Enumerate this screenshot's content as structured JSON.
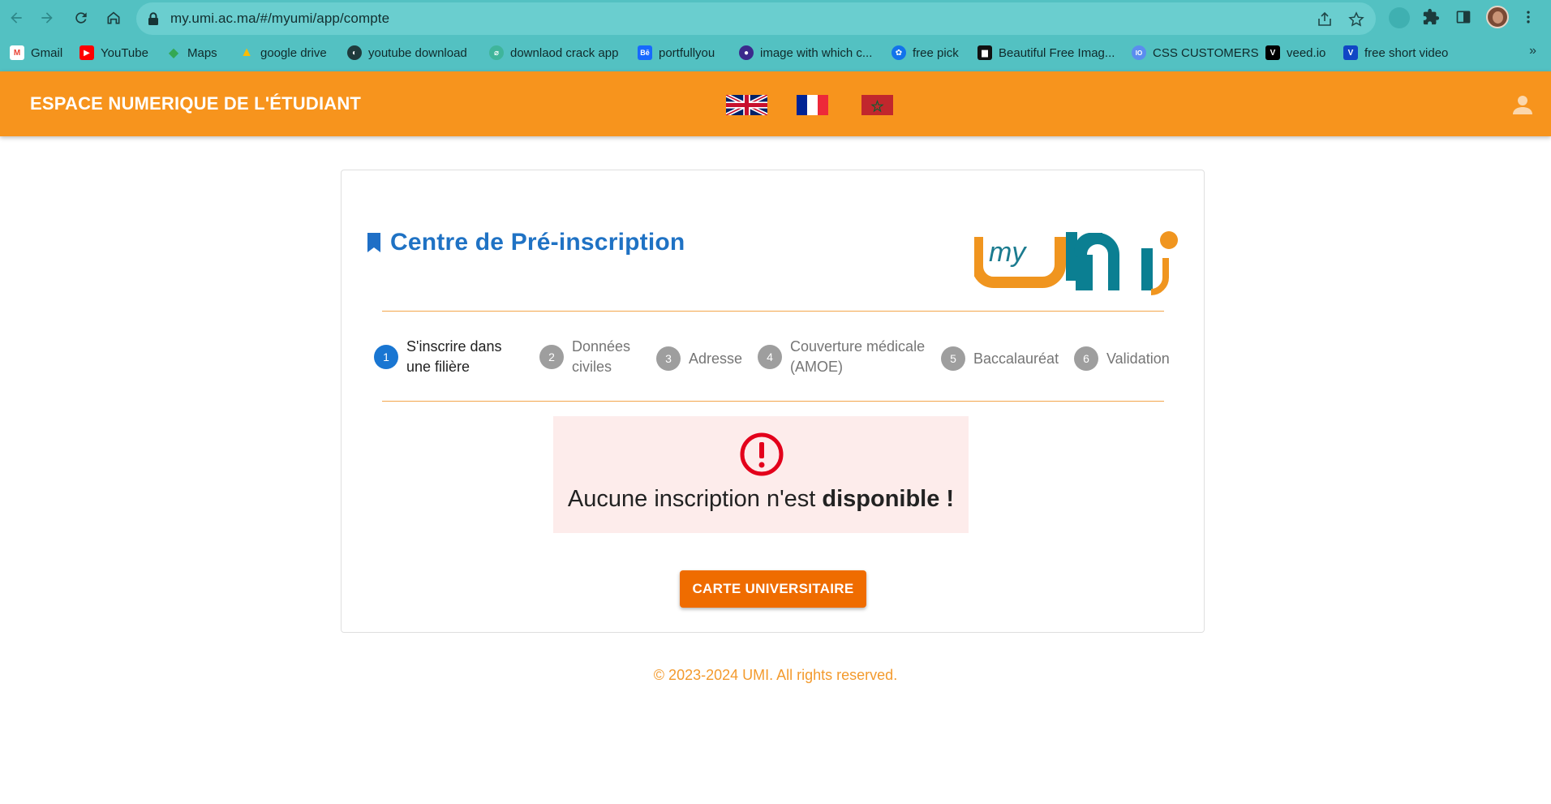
{
  "browser": {
    "url": "my.umi.ac.ma/#/myumi/app/compte",
    "bookmarks": [
      {
        "label": "Gmail",
        "icon": "gmail-icon",
        "color": "#ea4335"
      },
      {
        "label": "YouTube",
        "icon": "youtube-icon",
        "color": "#ff0000"
      },
      {
        "label": "Maps",
        "icon": "maps-icon",
        "color": "#34a853"
      },
      {
        "label": "google drive",
        "icon": "drive-icon",
        "color": "#fbbc04"
      },
      {
        "label": "youtube download",
        "icon": "globe-icon",
        "color": "#1f3b3c"
      },
      {
        "label": "downlaod crack app",
        "icon": "crack-app-icon",
        "color": "#3fb59b"
      },
      {
        "label": "portfullyou",
        "icon": "behance-icon",
        "color": "#1769ff"
      },
      {
        "label": "image with which c...",
        "icon": "image-site-icon",
        "color": "#3b2a8c"
      },
      {
        "label": "free pick",
        "icon": "freepik-icon",
        "color": "#1273eb"
      },
      {
        "label": "Beautiful Free Imag...",
        "icon": "unsplash-icon",
        "color": "#111111"
      },
      {
        "label": "CSS CUSTOMERS",
        "icon": "css-icon",
        "color": "#5b8def"
      },
      {
        "label": "veed.io",
        "icon": "veed-icon",
        "color": "#000000"
      },
      {
        "label": "free short video",
        "icon": "video-site-icon",
        "color": "#1146c5"
      }
    ],
    "more": "»"
  },
  "header": {
    "title": "ESPACE NUMERIQUE DE L'ÉTUDIANT"
  },
  "card": {
    "title": "Centre de Pré-inscription",
    "steps": [
      {
        "num": "1",
        "line1": "S'inscrire dans",
        "line2": "une filière",
        "active": true
      },
      {
        "num": "2",
        "line1": "Données",
        "line2": "civiles",
        "active": false
      },
      {
        "num": "3",
        "line1": "Adresse",
        "line2": "",
        "active": false
      },
      {
        "num": "4",
        "line1": "Couverture médicale",
        "line2": "(AMOE)",
        "active": false
      },
      {
        "num": "5",
        "line1": "Baccalauréat",
        "line2": "",
        "active": false
      },
      {
        "num": "6",
        "line1": "Validation",
        "line2": "",
        "active": false
      }
    ],
    "alert": {
      "text_normal": "Aucune inscription n'est ",
      "text_bold": "disponible !"
    },
    "button_label": "CARTE UNIVERSITAIRE"
  },
  "footer": {
    "text": "© 2023-2024 UMI. All rights reserved."
  },
  "colors": {
    "header": "#f7941d",
    "accent_blue": "#1f72c4",
    "button": "#ef6c00",
    "alert_bg": "#fdeceb"
  }
}
